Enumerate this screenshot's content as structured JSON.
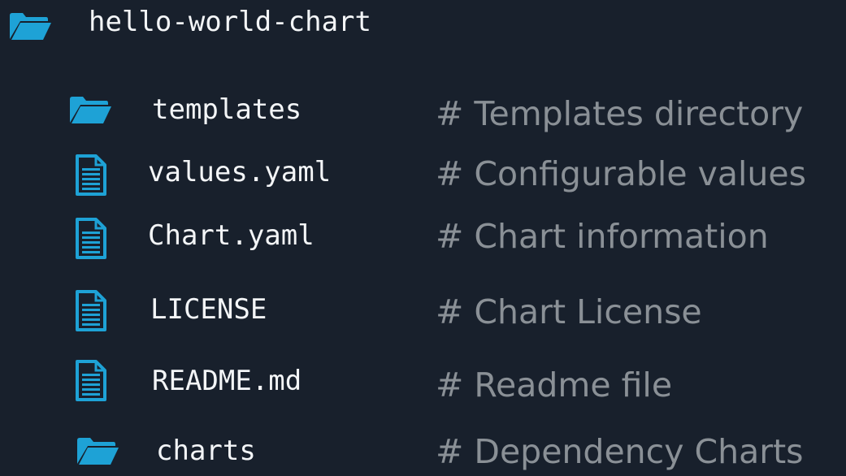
{
  "colors": {
    "background": "#18202c",
    "icon": "#1ea2d6",
    "filename": "#f3f5f7",
    "comment": "#8a9096"
  },
  "root": {
    "name": "hello-world-chart",
    "icon": "folder-icon"
  },
  "entries": [
    {
      "name": "templates",
      "comment": "# Templates directory",
      "icon": "folder-icon"
    },
    {
      "name": "values.yaml",
      "comment": "# Configurable values",
      "icon": "file-icon"
    },
    {
      "name": "Chart.yaml",
      "comment": "# Chart information",
      "icon": "file-icon"
    },
    {
      "name": "LICENSE",
      "comment": "# Chart License",
      "icon": "file-icon"
    },
    {
      "name": "README.md",
      "comment": "# Readme file",
      "icon": "file-icon"
    },
    {
      "name": "charts",
      "comment": "# Dependency Charts",
      "icon": "folder-icon"
    }
  ]
}
